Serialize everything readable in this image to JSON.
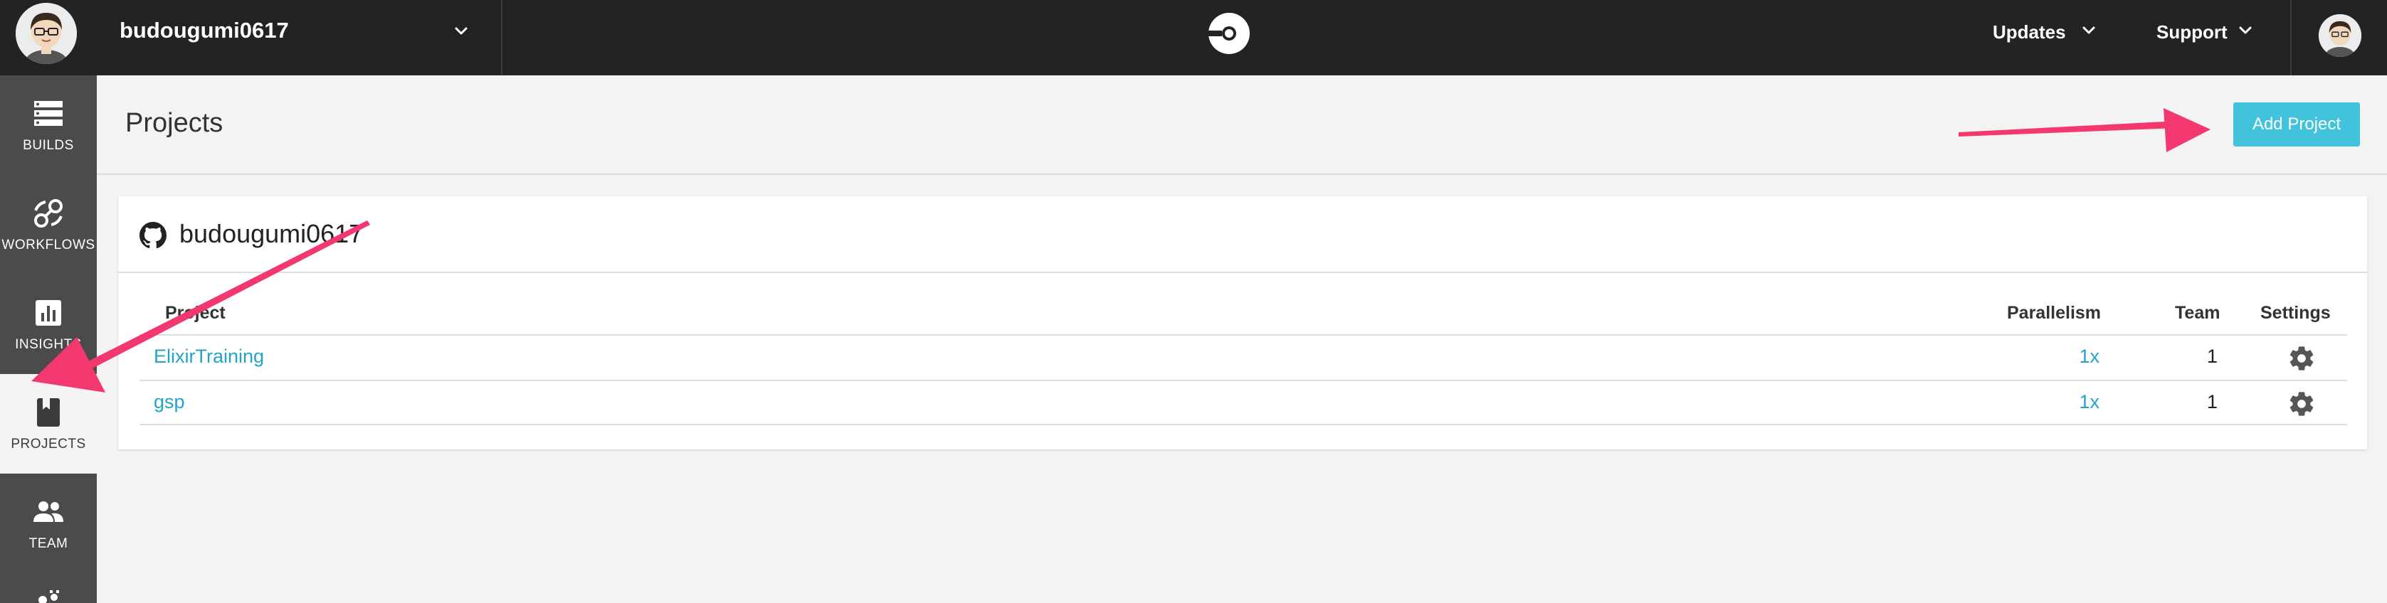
{
  "topbar": {
    "org_name": "budougumi0617",
    "menus": [
      {
        "label": "Updates"
      },
      {
        "label": "Support"
      }
    ]
  },
  "sidebar": {
    "items": [
      {
        "label": "BUILDS",
        "icon": "builds-icon",
        "active": false
      },
      {
        "label": "WORKFLOWS",
        "icon": "workflows-icon",
        "active": false
      },
      {
        "label": "INSIGHTS",
        "icon": "insights-icon",
        "active": false
      },
      {
        "label": "PROJECTS",
        "icon": "projects-icon",
        "active": true
      },
      {
        "label": "TEAM",
        "icon": "team-icon",
        "active": false
      }
    ]
  },
  "page": {
    "title": "Projects",
    "add_button": "Add Project"
  },
  "card": {
    "org": "budougumi0617",
    "columns": {
      "project": "Project",
      "parallelism": "Parallelism",
      "team": "Team",
      "settings": "Settings"
    },
    "rows": [
      {
        "project": "ElixirTraining",
        "parallelism": "1x",
        "team": "1"
      },
      {
        "project": "gsp",
        "parallelism": "1x",
        "team": "1"
      }
    ]
  },
  "colors": {
    "topbar": "#232323",
    "sidebar": "#4b4b4b",
    "accent": "#42c3dc",
    "link": "#24a3c3",
    "annotation_arrow": "#f2386e"
  }
}
